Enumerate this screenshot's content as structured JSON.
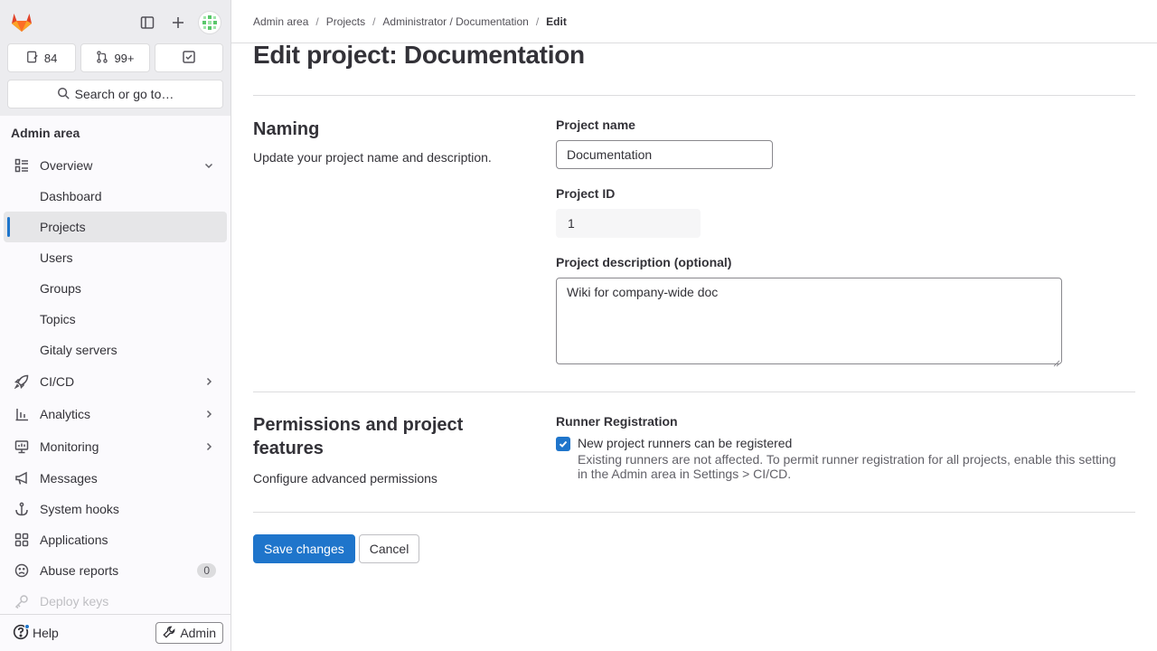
{
  "sidebar": {
    "counters": {
      "issues": "84",
      "merge_requests": "99+"
    },
    "search_label": "Search or go to…",
    "section_title": "Admin area",
    "overview_label": "Overview",
    "sub_items": [
      "Dashboard",
      "Projects",
      "Users",
      "Groups",
      "Topics",
      "Gitaly servers"
    ],
    "items": {
      "cicd": "CI/CD",
      "analytics": "Analytics",
      "monitoring": "Monitoring",
      "messages": "Messages",
      "system_hooks": "System hooks",
      "applications": "Applications",
      "abuse_reports": "Abuse reports",
      "abuse_reports_count": "0",
      "deploy_keys": "Deploy keys"
    },
    "help_label": "Help",
    "admin_label": "Admin"
  },
  "breadcrumb": [
    "Admin area",
    "Projects",
    "Administrator / Documentation",
    "Edit"
  ],
  "page_title": "Edit project: Documentation",
  "naming": {
    "title": "Naming",
    "description": "Update your project name and description.",
    "project_name_label": "Project name",
    "project_name_value": "Documentation",
    "project_id_label": "Project ID",
    "project_id_value": "1",
    "project_description_label": "Project description (optional)",
    "project_description_value": "Wiki for company-wide doc"
  },
  "permissions": {
    "title": "Permissions and project features",
    "description": "Configure advanced permissions",
    "runner_label": "Runner Registration",
    "checkbox_label": "New project runners can be registered",
    "help_text": "Existing runners are not affected. To permit runner registration for all projects, enable this setting in the Admin area in Settings > CI/CD.",
    "checked": true
  },
  "actions": {
    "save_label": "Save changes",
    "cancel_label": "Cancel"
  },
  "colors": {
    "primary": "#1f75cb",
    "sidebar_bg": "#fbfafd"
  }
}
